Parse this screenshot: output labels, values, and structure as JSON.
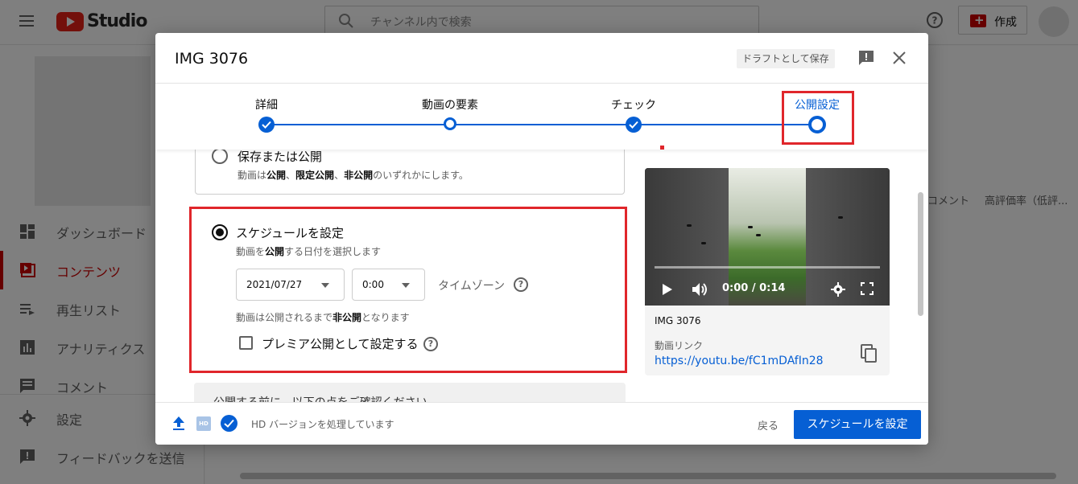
{
  "app": {
    "logo_text": "Studio",
    "search_placeholder": "チャンネル内で検索",
    "create_label": "作成"
  },
  "sidebar": {
    "items": [
      {
        "label": "ダッシュボード",
        "icon": "dashboard-icon"
      },
      {
        "label": "コンテンツ",
        "icon": "content-icon",
        "active": true
      },
      {
        "label": "再生リスト",
        "icon": "playlist-icon"
      },
      {
        "label": "アナリティクス",
        "icon": "analytics-icon"
      },
      {
        "label": "コメント",
        "icon": "comment-icon"
      },
      {
        "label": "設定",
        "icon": "gear-icon"
      },
      {
        "label": "フィードバックを送信",
        "icon": "feedback-icon"
      }
    ]
  },
  "table_headers": [
    "コメント",
    "高評価率（低評..."
  ],
  "dialog": {
    "title": "IMG 3076",
    "draft_label": "ドラフトとして保存",
    "steps": [
      {
        "label": "詳細",
        "state": "done"
      },
      {
        "label": "動画の要素",
        "state": "visited"
      },
      {
        "label": "チェック",
        "state": "done"
      },
      {
        "label": "公開設定",
        "state": "current"
      }
    ],
    "save_or_publish": {
      "title": "保存または公開",
      "sub_pre": "動画は",
      "sub_b1": "公開",
      "sub_sep1": "、",
      "sub_b2": "限定公開",
      "sub_sep2": "、",
      "sub_b3": "非公開",
      "sub_post": "のいずれかにします。"
    },
    "schedule": {
      "title": "スケジュールを設定",
      "sub_pre": "動画を",
      "sub_b": "公開",
      "sub_post": "する日付を選択します",
      "date": "2021/07/27",
      "time": "0:00",
      "timezone_label": "タイムゾーン",
      "note_pre": "動画は公開されるまで",
      "note_b": "非公開",
      "note_post": "となります",
      "premiere_label": "プレミア公開として設定する"
    },
    "notice": "公開する前に、以下の点をご確認ください",
    "preview": {
      "time": "0:00 / 0:14",
      "filename": "IMG 3076",
      "link_label": "動画リンク",
      "link": "https://youtu.be/fC1mDAfIn28"
    },
    "footer": {
      "hd_badge": "HD",
      "status": "HD バージョンを処理しています",
      "back_label": "戻る",
      "primary_label": "スケジュールを設定"
    }
  },
  "colors": {
    "accent": "#065fd4",
    "highlight_red": "#e0262b",
    "brand_red": "#cc0000"
  }
}
